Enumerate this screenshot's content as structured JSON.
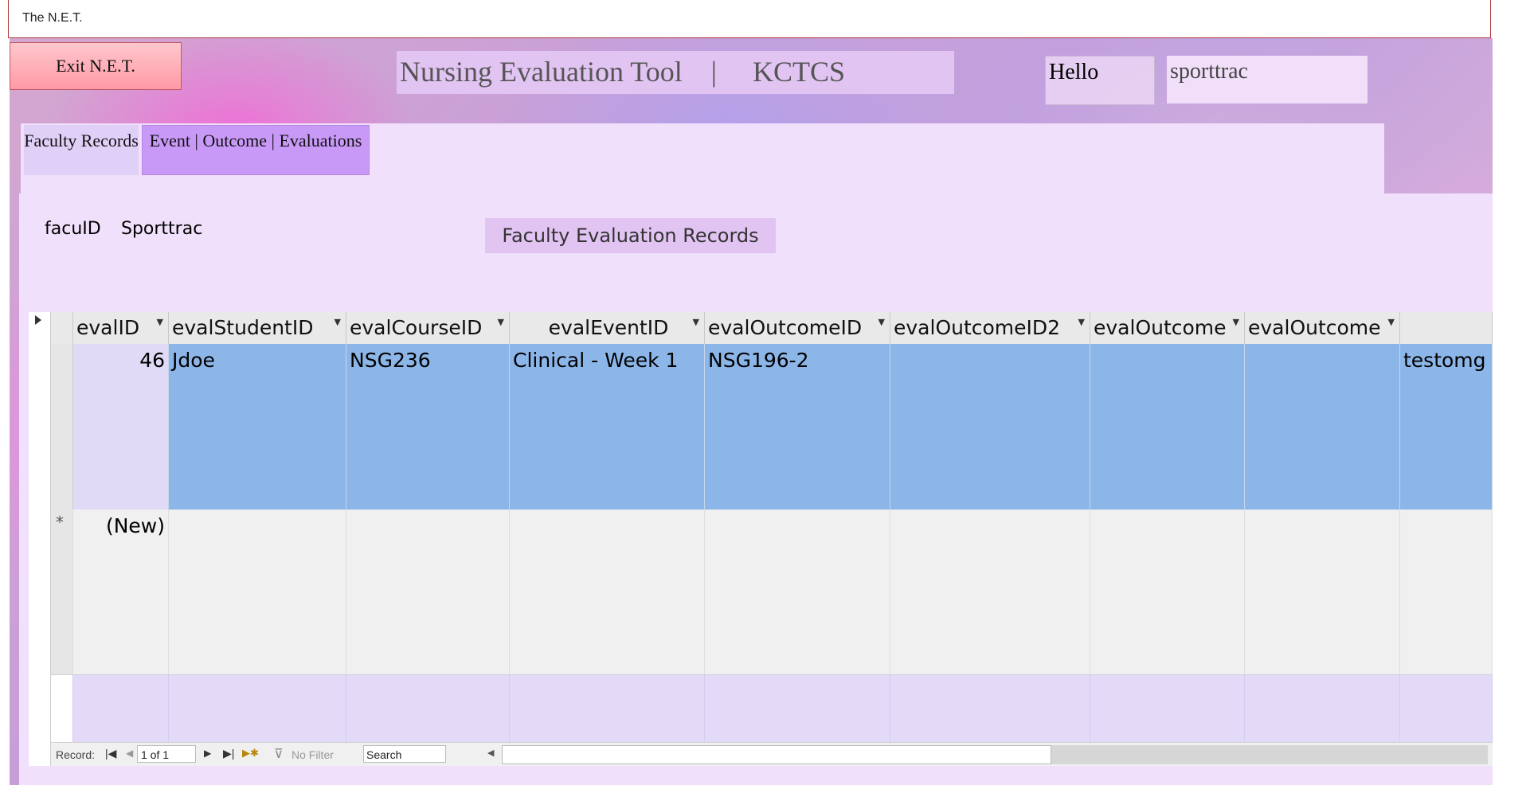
{
  "window": {
    "title": "The N.E.T."
  },
  "header": {
    "exit_label": "Exit N.E.T.",
    "app_title": "Nursing Evaluation Tool    |     KCTCS",
    "hello_label": "Hello",
    "username": "sporttrac"
  },
  "tabs": [
    {
      "label": "Faculty Records",
      "active": false
    },
    {
      "label": "Event | Outcome | Evaluations",
      "active": true
    }
  ],
  "panel": {
    "facu_label": "facuID",
    "facu_value": "Sporttrac",
    "title": "Faculty Evaluation Records"
  },
  "datasheet": {
    "columns": [
      "evalID",
      "evalStudentID",
      "evalCourseID",
      "evalEventID",
      "evalOutcomeID",
      "evalOutcomeID2",
      "evalOutcome",
      "evalOutcome",
      ""
    ],
    "rows": [
      {
        "selector": "",
        "cells": [
          "46",
          "Jdoe",
          "NSG236",
          "Clinical - Week 1",
          "NSG196-2",
          "",
          "",
          "",
          "testomg"
        ]
      },
      {
        "selector": "*",
        "cells": [
          "(New)",
          "",
          "",
          "",
          "",
          "",
          "",
          "",
          ""
        ]
      }
    ]
  },
  "navbar": {
    "record_label": "Record:",
    "position": "1 of 1",
    "filter_label": "No Filter",
    "search_placeholder": "Search"
  },
  "colors": {
    "selected_row": "#8cb6e8",
    "new_row": "#f0f0f0",
    "header_bg": "#e9e9e9",
    "panel_bg": "#f1e0fb",
    "exit_button": "#ffb3bb",
    "active_tab": "#c999f7"
  }
}
